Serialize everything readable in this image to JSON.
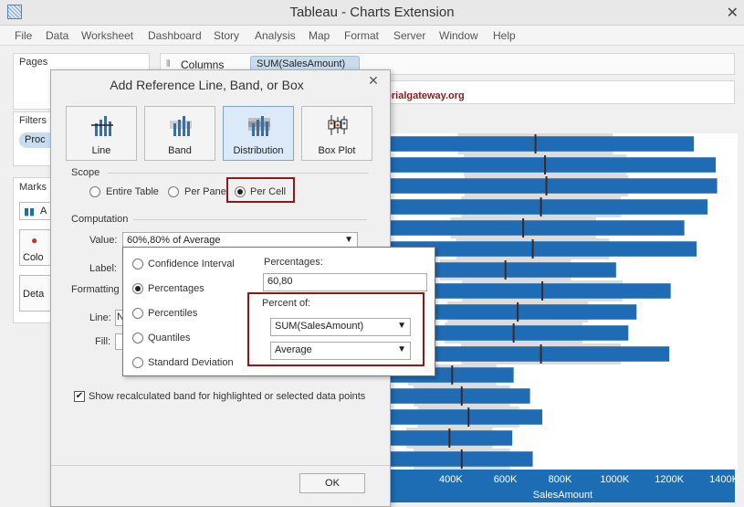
{
  "window": {
    "title": "Tableau - Charts Extension"
  },
  "menu": [
    "File",
    "Data",
    "Worksheet",
    "Dashboard",
    "Story",
    "Analysis",
    "Map",
    "Format",
    "Server",
    "Window",
    "Help"
  ],
  "left": {
    "pages_label": "Pages",
    "filters_label": "Filters",
    "filter_pill": "Proc",
    "marks_label": "Marks",
    "marks_type": "A",
    "color_label": "Colo",
    "detail_label": "Deta"
  },
  "shelf": {
    "columns_label": "Columns",
    "columns_pill": "SUM(SalesAmount)"
  },
  "watermark": "©tutorialgateway.org",
  "dialog": {
    "title": "Add Reference Line, Band, or Box",
    "types": [
      "Line",
      "Band",
      "Distribution",
      "Box Plot"
    ],
    "scope_label": "Scope",
    "scope_options": [
      "Entire Table",
      "Per Pane",
      "Per Cell"
    ],
    "computation_label": "Computation",
    "value_label": "Value:",
    "value_selected": "60%,80% of Average",
    "label_label": "Label:",
    "formatting_label": "Formatting",
    "line_label": "Line:",
    "line_value": "N",
    "fill_label": "Fill:",
    "show_band_text": "Show recalculated band for highlighted or selected data points",
    "ok_label": "OK"
  },
  "popup": {
    "options": [
      "Confidence Interval",
      "Percentages",
      "Percentiles",
      "Quantiles",
      "Standard Deviation"
    ],
    "percentages_label": "Percentages:",
    "percentages_value": "60,80",
    "percent_of_label": "Percent of:",
    "measure_selected": "SUM(SalesAmount)",
    "aggregation_selected": "Average"
  },
  "chart_data": {
    "type": "bar",
    "orientation": "horizontal",
    "xlabel": "SalesAmount",
    "x_ticks": [
      "400K",
      "600K",
      "800K",
      "1000K",
      "1200K",
      "1400K"
    ],
    "xlim": [
      180000,
      1450000
    ],
    "bar_color": "#1f6cb5",
    "bars": [
      1290000,
      1370000,
      1375000,
      1340000,
      1255000,
      1300000,
      1005000,
      1205000,
      1080000,
      1050000,
      1200000,
      630000,
      690000,
      735000,
      625000,
      700000
    ],
    "markers": [
      710000,
      745000,
      750000,
      730000,
      665000,
      700000,
      600000,
      735000,
      645000,
      630000,
      730000,
      405000,
      440000,
      465000,
      395000,
      440000
    ]
  }
}
